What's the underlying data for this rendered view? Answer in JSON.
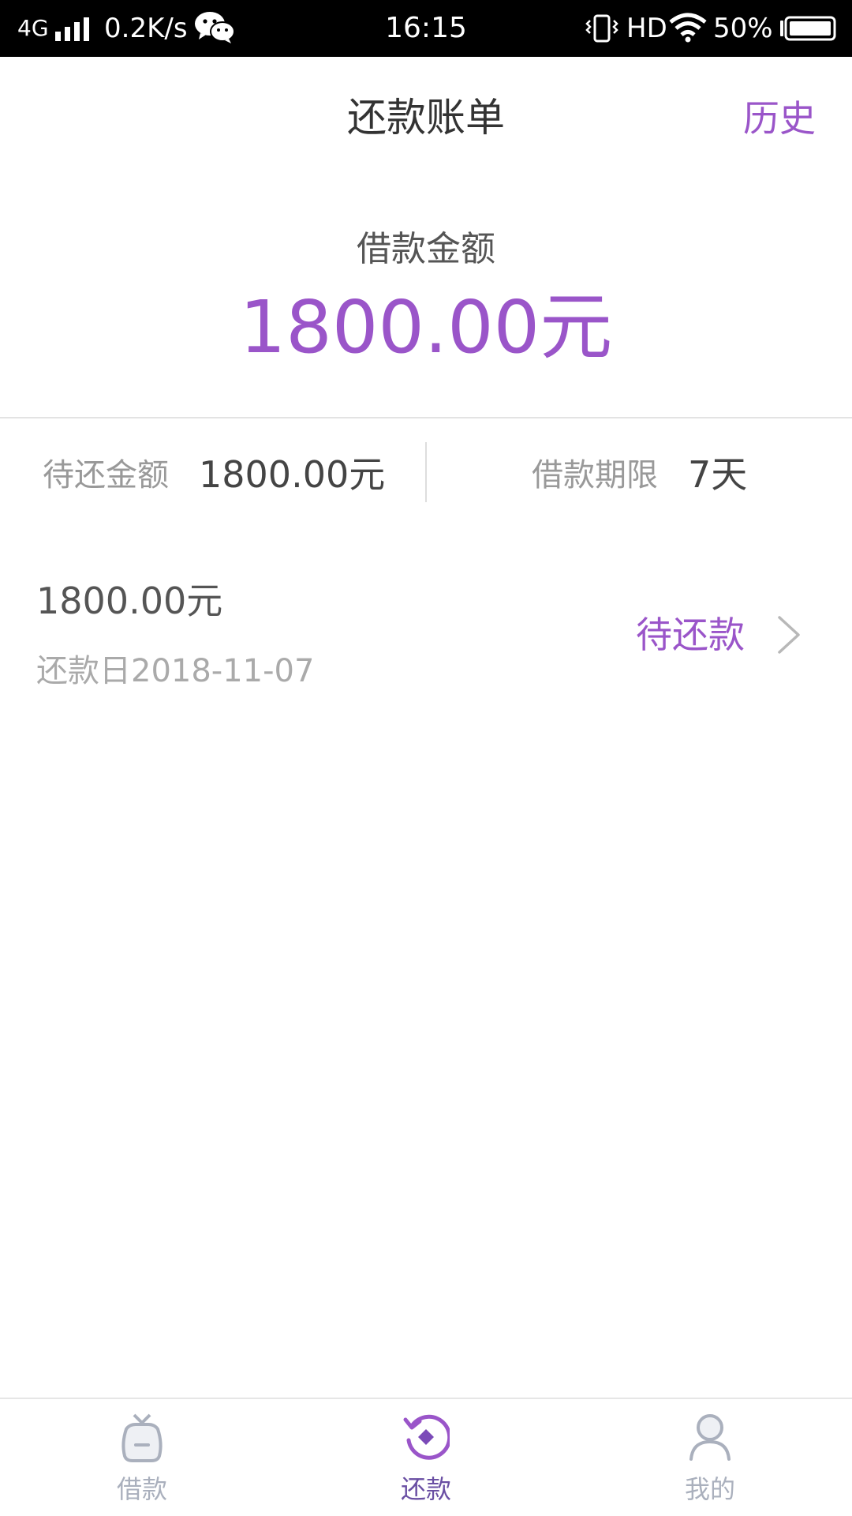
{
  "status_bar": {
    "network": "4G",
    "speed": "0.2K/s",
    "time": "16:15",
    "hd": "HD",
    "battery": "50%"
  },
  "header": {
    "title": "还款账单",
    "history_label": "历史"
  },
  "summary": {
    "loan_label": "借款金额",
    "loan_amount": "1800.00元"
  },
  "info": {
    "pending_label": "待还金额",
    "pending_value": "1800.00元",
    "term_label": "借款期限",
    "term_value": "7天"
  },
  "bill": {
    "amount": "1800.00元",
    "due_date": "还款日2018-11-07",
    "status": "待还款"
  },
  "tabs": [
    {
      "label": "借款",
      "icon": "loan-bag-icon",
      "active": false
    },
    {
      "label": "还款",
      "icon": "repay-icon",
      "active": true
    },
    {
      "label": "我的",
      "icon": "user-icon",
      "active": false
    }
  ],
  "colors": {
    "accent": "#9a55c9",
    "tab_active": "#6a4fa3",
    "tab_inactive": "#aab0bd"
  }
}
